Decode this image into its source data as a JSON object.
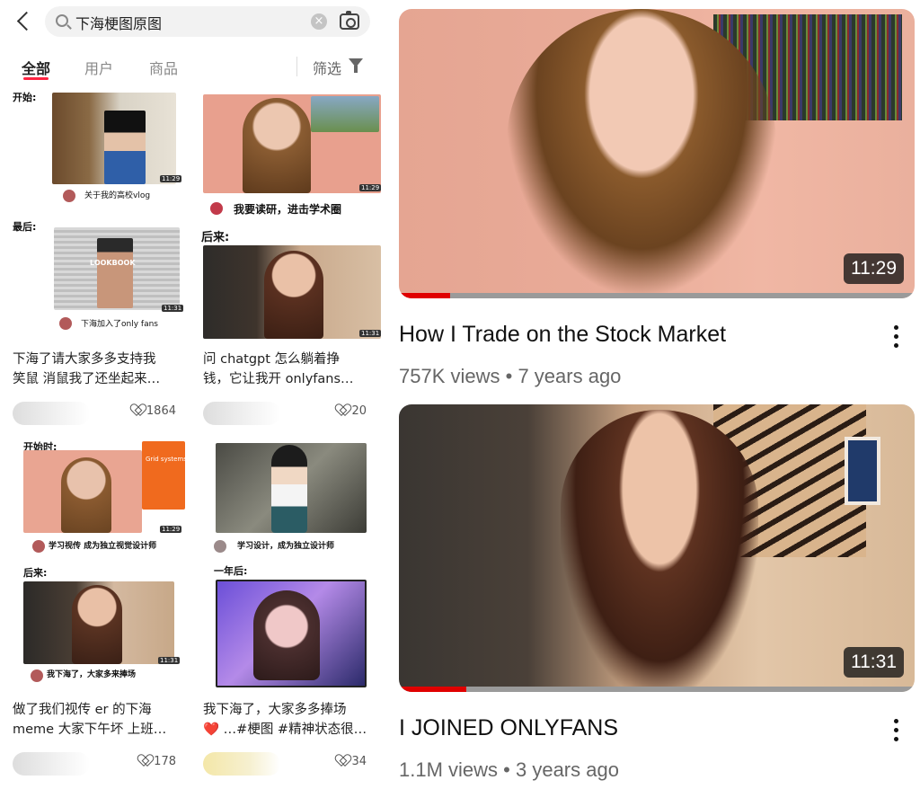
{
  "app": {
    "search": {
      "query": "下海梗图原图",
      "clear_glyph": "×"
    },
    "tabs": [
      {
        "label": "全部"
      },
      {
        "label": "用户"
      },
      {
        "label": "商品"
      }
    ],
    "filter_label": "筛选",
    "posts": [
      {
        "panels": [
          {
            "caption": "开始:",
            "tiny_title": "关于我的高校vlog",
            "duration": "11:29"
          },
          {
            "caption": "最后:",
            "tiny_title": "下海加入了only fans",
            "duration": "11:31",
            "overlay": "LOOKBOOK"
          }
        ],
        "title": "下海了请大家多多支持我\n笑鼠 消鼠我了还坐起来…",
        "likes": "1864"
      },
      {
        "panels": [
          {
            "caption": "",
            "tiny_title": "我要读研，进击学术圈",
            "duration": "11:29"
          },
          {
            "caption": "后来:",
            "tiny_title": "",
            "duration": "11:31"
          }
        ],
        "title": "问 chatgpt 怎么躺着挣\n钱，它让我开 onlyfans…",
        "likes": "20"
      },
      {
        "panels": [
          {
            "caption": "开始时:",
            "tiny_title": "学习视传   成为独立视觉设计师",
            "duration": "11:29",
            "book": "Grid systems"
          },
          {
            "caption": "后来:",
            "tiny_title": "我下海了，大家多来捧场",
            "duration": "11:31"
          }
        ],
        "title": "做了我们视传 er 的下海\nmeme 大家下午坏 上班…",
        "likes": "178"
      },
      {
        "panels": [
          {
            "caption": "",
            "tiny_title": "学习设计，成为独立设计师",
            "duration": ""
          },
          {
            "caption": "一年后:",
            "tiny_title": "",
            "duration": ""
          }
        ],
        "title": "我下海了，大家多多捧场\n❤️ …#梗图 #精神状态很…",
        "likes": "34"
      }
    ]
  },
  "videos": [
    {
      "title": "How I Trade on the Stock Market",
      "views": "757K views",
      "age": "7 years ago",
      "duration": "11:29",
      "progress": 0.1
    },
    {
      "title": "I JOINED ONLYFANS",
      "views": "1.1M views",
      "age": "3 years ago",
      "duration": "11:31",
      "progress": 0.13
    }
  ],
  "colors": {
    "accent": "#ff2442",
    "progress": "#e00000"
  }
}
